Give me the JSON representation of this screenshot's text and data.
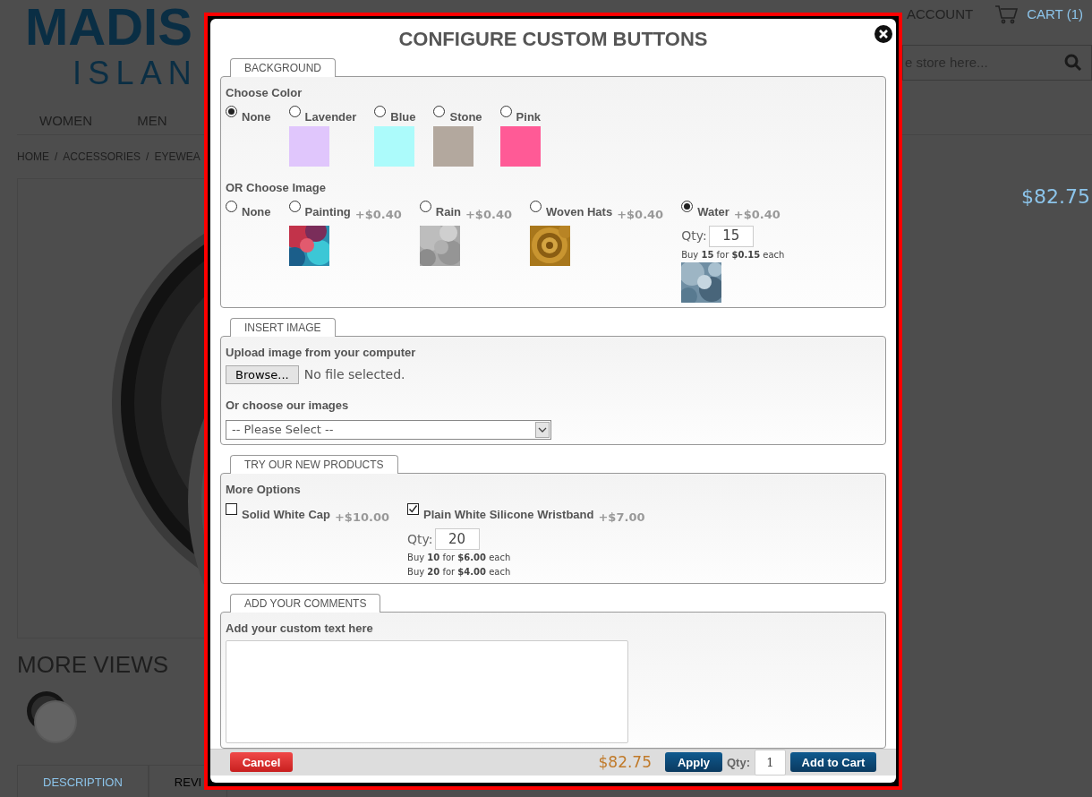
{
  "page": {
    "logo": {
      "line_1": "MADIS",
      "line_2": "ISLAN"
    },
    "account": "ACCOUNT",
    "cart": "CART (1)",
    "search": {
      "placeholder": "e store here..."
    },
    "nav": [
      "WOMEN",
      "MEN"
    ],
    "breadcrumb": [
      {
        "label": "HOME",
        "separator": "/"
      },
      {
        "label": "ACCESSORIES",
        "separator": "/"
      },
      {
        "label": "EYEWEA"
      }
    ],
    "price": "$82.75",
    "more_views": "MORE VIEWS",
    "tabs": [
      {
        "label": "DESCRIPTION",
        "selected": true
      },
      {
        "label": "REVI",
        "selected": false
      }
    ]
  },
  "dialog": {
    "title": "CONFIGURE CUSTOM BUTTONS",
    "sections": [
      {
        "kind": "background",
        "tab": "BACKGROUND",
        "color_label": "Choose Color",
        "colors": [
          {
            "label": "None",
            "selected": true
          },
          {
            "label": "Lavender",
            "selected": false,
            "color": "#e0c6fc"
          },
          {
            "label": "Blue",
            "selected": false,
            "color": "#acfbfb"
          },
          {
            "label": "Stone",
            "selected": false,
            "color": "#b3a89e"
          },
          {
            "label": "Pink",
            "selected": false,
            "color": "#ff5a96"
          }
        ],
        "image_label": "OR Choose Image",
        "images": [
          {
            "label": "None",
            "selected": false
          },
          {
            "label": "Painting",
            "price": "+$0.40",
            "selected": false,
            "kind": "picture"
          },
          {
            "label": "Rain",
            "price": "+$0.40",
            "selected": false,
            "kind": "picture"
          },
          {
            "label": "Woven Hats",
            "price": "+$0.40",
            "selected": false,
            "kind": "picture"
          },
          {
            "label": "Water",
            "price": "+$0.40",
            "selected": true,
            "kind": "picture",
            "qty_label": "Qty:",
            "qty": "15",
            "note": "Buy **15** for **$0.15** each"
          }
        ]
      },
      {
        "kind": "insert",
        "tab": "INSERT IMAGE",
        "upload_label": "Upload image from your computer",
        "browse": "Browse...",
        "file_status": "No file selected.",
        "choose_label": "Or choose our images",
        "select_value": "-- Please Select --"
      },
      {
        "kind": "products",
        "tab": "TRY OUR NEW PRODUCTS",
        "label": "More Options",
        "options": [
          {
            "label": "Solid White Cap",
            "price": "+$10.00",
            "checked": false
          },
          {
            "label": "Plain White Silicone Wristband",
            "price": "+$7.00",
            "checked": true,
            "qty_label": "Qty:",
            "qty": "20",
            "tiers": [
              "Buy **10** for **$6.00** each",
              "Buy **20** for **$4.00** each"
            ]
          }
        ]
      },
      {
        "kind": "comments",
        "tab": "ADD YOUR COMMENTS",
        "label": "Add your custom text here"
      }
    ],
    "footer": {
      "cancel": "Cancel",
      "price": "$82.75",
      "apply": "Apply",
      "qty_label": "Qty:",
      "qty": "1",
      "add_to_cart": "Add to Cart"
    }
  }
}
